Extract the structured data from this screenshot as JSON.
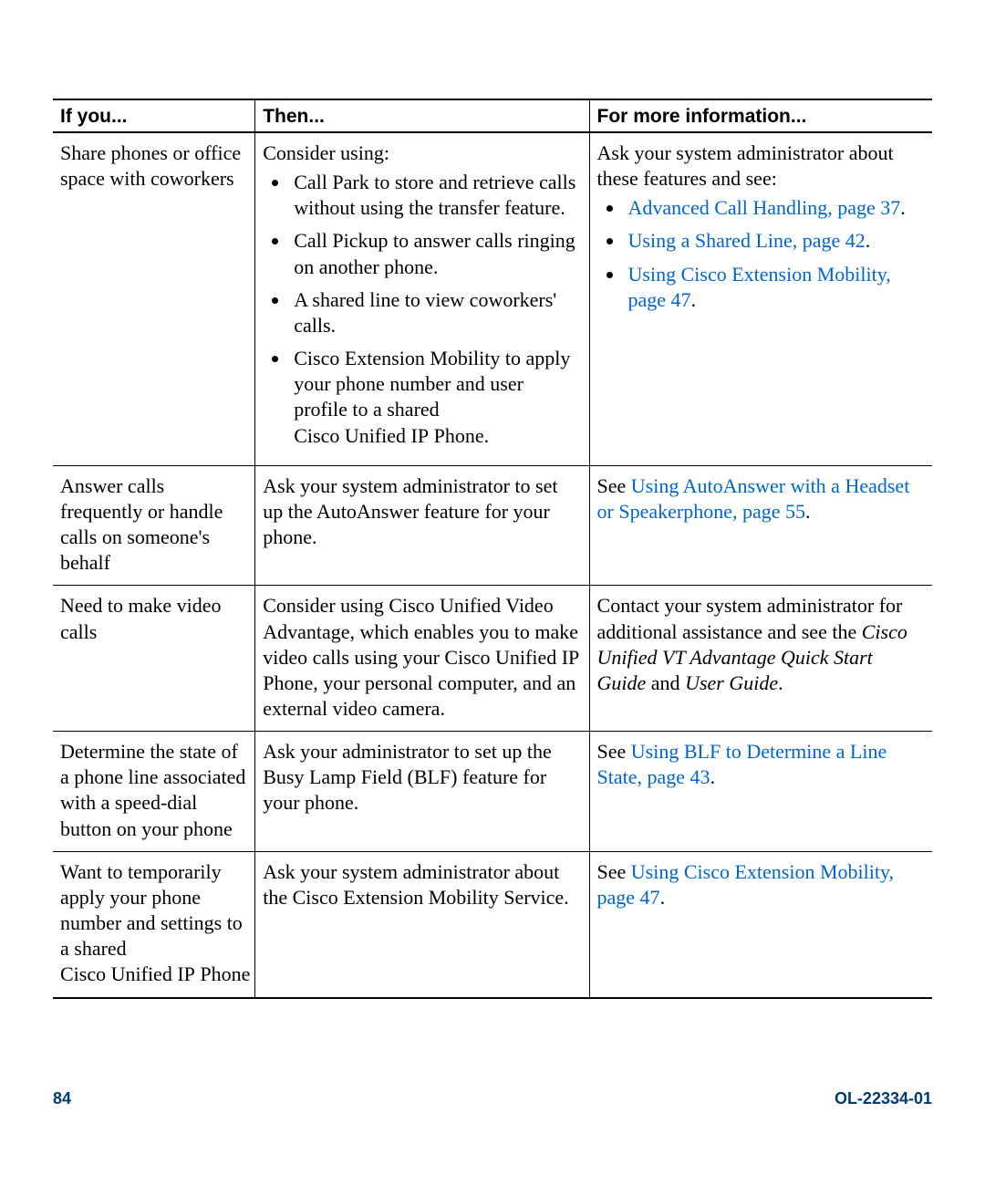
{
  "headers": {
    "c1": "If you...",
    "c2": "Then...",
    "c3": "For more information..."
  },
  "rows": {
    "r1": {
      "ifyou": "Share phones or office space with coworkers",
      "then_intro": "Consider using:",
      "then_li1": "Call Park to store and retrieve calls without using the transfer feature.",
      "then_li2": "Call Pickup to answer calls ringing on another phone.",
      "then_li3": "A shared line to view coworkers' calls.",
      "then_li4": "Cisco Extension Mobility to apply your phone number and user profile to a shared Cisco Unified IP Phone.",
      "info_intro": "Ask your system administrator about these features and see:",
      "info_li1_link": "Advanced Call Handling, page 37",
      "info_li1_after": ".",
      "info_li2_link": "Using a Shared Line, page 42",
      "info_li2_after": ".",
      "info_li3_link": "Using Cisco Extension Mobility, page 47",
      "info_li3_after": "."
    },
    "r2": {
      "ifyou": "Answer calls frequently or handle calls on someone's behalf",
      "then": "Ask your system administrator to set up the AutoAnswer feature for your phone.",
      "info_pre": "See ",
      "info_link": "Using AutoAnswer with a Headset or Speakerphone, page 55",
      "info_post": "."
    },
    "r3": {
      "ifyou": "Need to make video calls",
      "then": "Consider using Cisco Unified Video Advantage, which enables you to make video calls using your Cisco Unified IP Phone, your personal computer, and an external video camera.",
      "info_pre": "Contact your system administrator for additional assistance and see the ",
      "info_ital1": "Cisco Unified VT Advantage Quick Start Guide",
      "info_mid": " and ",
      "info_ital2": "User Guide",
      "info_post": "."
    },
    "r4": {
      "ifyou": "Determine the state of a phone line associated with a speed-dial button on your phone",
      "then": "Ask your administrator to set up the Busy Lamp Field (BLF) feature for your phone.",
      "info_pre": "See ",
      "info_link": "Using BLF to Determine a Line State, page 43",
      "info_post": "."
    },
    "r5": {
      "ifyou": "Want to temporarily apply your phone number and settings to a shared Cisco Unified IP Phone",
      "then": "Ask your system administrator about the Cisco Extension Mobility Service.",
      "info_pre": "See ",
      "info_link": "Using Cisco Extension Mobility, page 47",
      "info_post": "."
    }
  },
  "footer": {
    "page": "84",
    "doc": "OL-22334-01"
  }
}
